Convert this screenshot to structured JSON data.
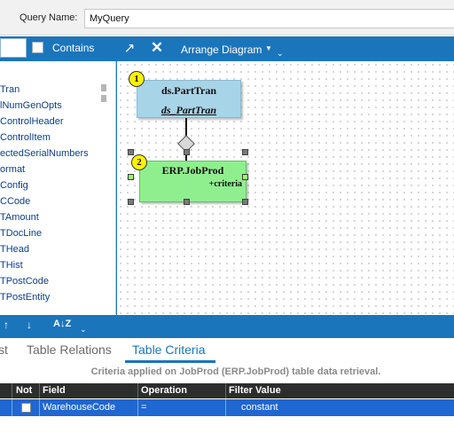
{
  "query": {
    "label": "Query Name:",
    "value": "MyQuery"
  },
  "left_panel": {
    "contains_label": "Contains",
    "items": [
      "Tran",
      "lNumGenOpts",
      "ControlHeader",
      "ControlItem",
      "ectedSerialNumbers",
      "ormat",
      "Config",
      "CCode",
      "TAmount",
      "TDocLine",
      "THead",
      "THist",
      "TPostCode",
      "TPostEntity"
    ]
  },
  "diagram_toolbar": {
    "arrange_label": "Arrange Diagram"
  },
  "diagram": {
    "nodes": [
      {
        "number": "1",
        "title": "ds.PartTran",
        "subtitle": "ds_PartTran",
        "color": "#a8d4e8"
      },
      {
        "number": "2",
        "title": "ERP.JobProd",
        "subtitle": "+criteria",
        "color": "#8fef8f"
      }
    ]
  },
  "bottom_toolbar": {
    "icons": [
      "arrow-up-icon",
      "arrow-down-icon",
      "sort-az-icon"
    ]
  },
  "tabs": [
    {
      "label": "st",
      "active": false
    },
    {
      "label": "Table Relations",
      "active": false
    },
    {
      "label": "Table Criteria",
      "active": true
    }
  ],
  "criteria_caption": "Criteria applied on JobProd (ERP.JobProd)  table data retrieval.",
  "grid": {
    "columns": [
      "Not",
      "Field",
      "Operation",
      "Filter Value"
    ],
    "rows": [
      {
        "not": false,
        "field": "WarehouseCode",
        "operation": "=",
        "filter_value": "constant"
      }
    ]
  },
  "colors": {
    "accent": "#1b75bb",
    "selected_row": "#1f67d1"
  }
}
